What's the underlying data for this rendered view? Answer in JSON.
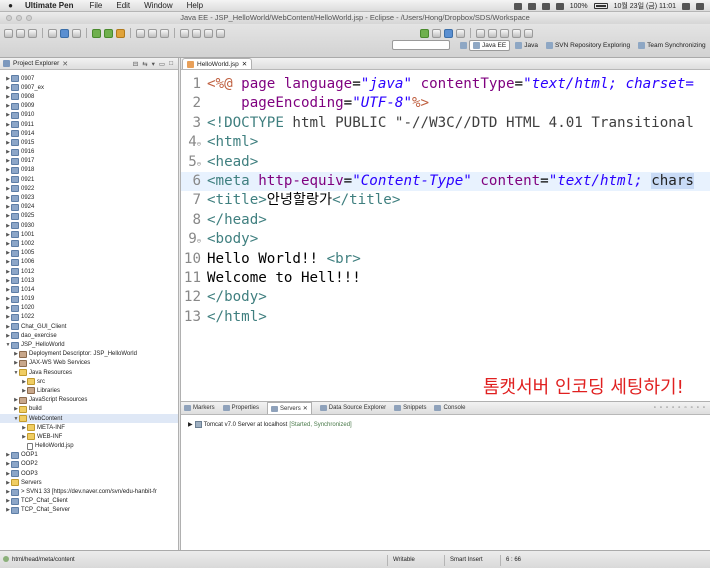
{
  "menubar": {
    "app": "Ultimate Pen",
    "items": [
      "File",
      "Edit",
      "Window",
      "Help"
    ],
    "battery": "100%",
    "datetime": "10월 23일 (금) 11:01"
  },
  "window": {
    "title": "Java EE - JSP_HelloWorld/WebContent/HelloWorld.jsp - Eclipse - /Users/Hong/Dropbox/SDS/Workspace"
  },
  "perspectives": [
    {
      "label": "Java EE",
      "active": true
    },
    {
      "label": "Java",
      "active": false
    },
    {
      "label": "SVN Repository Exploring",
      "active": false
    },
    {
      "label": "Team Synchronizing",
      "active": false
    }
  ],
  "explorer": {
    "title": "Project Explorer",
    "items": [
      {
        "label": "0907",
        "kind": "project",
        "depth": 0
      },
      {
        "label": "0907_ex",
        "kind": "project",
        "depth": 0
      },
      {
        "label": "0908",
        "kind": "project",
        "depth": 0
      },
      {
        "label": "0909",
        "kind": "project",
        "depth": 0
      },
      {
        "label": "0910",
        "kind": "project",
        "depth": 0
      },
      {
        "label": "0911",
        "kind": "project",
        "depth": 0
      },
      {
        "label": "0914",
        "kind": "project",
        "depth": 0
      },
      {
        "label": "0915",
        "kind": "project",
        "depth": 0
      },
      {
        "label": "0916",
        "kind": "project",
        "depth": 0
      },
      {
        "label": "0917",
        "kind": "project",
        "depth": 0
      },
      {
        "label": "0918",
        "kind": "project",
        "depth": 0
      },
      {
        "label": "0921",
        "kind": "project",
        "depth": 0
      },
      {
        "label": "0922",
        "kind": "project",
        "depth": 0
      },
      {
        "label": "0923",
        "kind": "project",
        "depth": 0
      },
      {
        "label": "0924",
        "kind": "project",
        "depth": 0
      },
      {
        "label": "0925",
        "kind": "project",
        "depth": 0
      },
      {
        "label": "0930",
        "kind": "project",
        "depth": 0
      },
      {
        "label": "1001",
        "kind": "project",
        "depth": 0
      },
      {
        "label": "1002",
        "kind": "project",
        "depth": 0
      },
      {
        "label": "1005",
        "kind": "project",
        "depth": 0
      },
      {
        "label": "1006",
        "kind": "project",
        "depth": 0
      },
      {
        "label": "1012",
        "kind": "project",
        "depth": 0
      },
      {
        "label": "1013",
        "kind": "project",
        "depth": 0
      },
      {
        "label": "1014",
        "kind": "project",
        "depth": 0
      },
      {
        "label": "1019",
        "kind": "project",
        "depth": 0
      },
      {
        "label": "1020",
        "kind": "project",
        "depth": 0
      },
      {
        "label": "1022",
        "kind": "project",
        "depth": 0
      },
      {
        "label": "Chat_GUI_Client",
        "kind": "project",
        "depth": 0
      },
      {
        "label": "dao_exercise",
        "kind": "project",
        "depth": 0
      },
      {
        "label": "JSP_HelloWorld",
        "kind": "project",
        "depth": 0,
        "expanded": true
      },
      {
        "label": "Deployment Descriptor: JSP_HelloWorld",
        "kind": "lib",
        "depth": 1
      },
      {
        "label": "JAX-WS Web Services",
        "kind": "lib",
        "depth": 1
      },
      {
        "label": "Java Resources",
        "kind": "folder",
        "depth": 1,
        "expanded": true
      },
      {
        "label": "src",
        "kind": "folder",
        "depth": 2
      },
      {
        "label": "Libraries",
        "kind": "lib",
        "depth": 2
      },
      {
        "label": "JavaScript Resources",
        "kind": "lib",
        "depth": 1
      },
      {
        "label": "build",
        "kind": "folder",
        "depth": 1
      },
      {
        "label": "WebContent",
        "kind": "folder",
        "depth": 1,
        "expanded": true,
        "selected": true
      },
      {
        "label": "META-INF",
        "kind": "folder",
        "depth": 2
      },
      {
        "label": "WEB-INF",
        "kind": "folder",
        "depth": 2
      },
      {
        "label": "HelloWorld.jsp",
        "kind": "file",
        "depth": 2
      },
      {
        "label": "OOP1",
        "kind": "project",
        "depth": 0
      },
      {
        "label": "OOP2",
        "kind": "project",
        "depth": 0
      },
      {
        "label": "OOP3",
        "kind": "project",
        "depth": 0
      },
      {
        "label": "Servers",
        "kind": "folder",
        "depth": 0
      },
      {
        "label": "> SVN1 33 [https://dev.naver.com/svn/edu-hanbit-fr",
        "kind": "project",
        "depth": 0
      },
      {
        "label": "TCP_Chat_Client",
        "kind": "project",
        "depth": 0
      },
      {
        "label": "TCP_Chat_Server",
        "kind": "project",
        "depth": 0
      }
    ]
  },
  "editor": {
    "tab": "HelloWorld.jsp",
    "overlay_text": "톰캣서버 인코딩 세팅하기!",
    "lines": [
      {
        "n": "1",
        "fold": "",
        "parts": [
          [
            "pct",
            "<%@ "
          ],
          [
            "attr",
            "page language"
          ],
          [
            "txt",
            "="
          ],
          [
            "val",
            "\"java\""
          ],
          [
            "txt",
            " "
          ],
          [
            "attr",
            "contentType"
          ],
          [
            "txt",
            "="
          ],
          [
            "val",
            "\"text/html; charset="
          ]
        ]
      },
      {
        "n": "2",
        "fold": "",
        "parts": [
          [
            "txt",
            "    "
          ],
          [
            "attr",
            "pageEncoding"
          ],
          [
            "txt",
            "="
          ],
          [
            "val",
            "\"UTF-8\""
          ],
          [
            "pct",
            "%>"
          ]
        ]
      },
      {
        "n": "3",
        "fold": "",
        "parts": [
          [
            "tag",
            "<!DOCTYPE "
          ],
          [
            "dt",
            "html PUBLIC \"-//W3C//DTD HTML 4.01 Transitional"
          ]
        ]
      },
      {
        "n": "4",
        "fold": "⊖",
        "parts": [
          [
            "tag",
            "<html>"
          ]
        ]
      },
      {
        "n": "5",
        "fold": "⊖",
        "parts": [
          [
            "tag",
            "<head>"
          ]
        ]
      },
      {
        "n": "6",
        "fold": "",
        "cur": true,
        "parts": [
          [
            "tag",
            "<meta "
          ],
          [
            "attr",
            "http-equiv"
          ],
          [
            "txt",
            "="
          ],
          [
            "val",
            "\"Content-Type\""
          ],
          [
            "txt",
            " "
          ],
          [
            "attr",
            "content"
          ],
          [
            "txt",
            "="
          ],
          [
            "val",
            "\"text/html; "
          ],
          [
            "hl",
            "chars"
          ]
        ]
      },
      {
        "n": "7",
        "fold": "",
        "parts": [
          [
            "tag",
            "<title>"
          ],
          [
            "txt",
            "안녕할랑가"
          ],
          [
            "tag",
            "</title>"
          ]
        ]
      },
      {
        "n": "8",
        "fold": "",
        "parts": [
          [
            "tag",
            "</head>"
          ]
        ]
      },
      {
        "n": "9",
        "fold": "⊖",
        "parts": [
          [
            "tag",
            "<body>"
          ]
        ]
      },
      {
        "n": "10",
        "fold": "",
        "parts": [
          [
            "txt",
            "Hello World!! "
          ],
          [
            "tag",
            "<br>"
          ]
        ]
      },
      {
        "n": "11",
        "fold": "",
        "parts": [
          [
            "txt",
            "Welcome to Hell!!!"
          ]
        ]
      },
      {
        "n": "12",
        "fold": "",
        "parts": [
          [
            "tag",
            "</body>"
          ]
        ]
      },
      {
        "n": "13",
        "fold": "",
        "parts": [
          [
            "tag",
            "</html>"
          ]
        ]
      }
    ]
  },
  "bottom_panel": {
    "tabs": [
      {
        "label": "Markers",
        "active": false
      },
      {
        "label": "Properties",
        "active": false
      },
      {
        "label": "Servers",
        "active": true
      },
      {
        "label": "Data Source Explorer",
        "active": false
      },
      {
        "label": "Snippets",
        "active": false
      },
      {
        "label": "Console",
        "active": false
      }
    ],
    "server": {
      "name": "Tomcat v7.0 Server at localhost",
      "state": "[Started, Synchronized]"
    }
  },
  "statusbar": {
    "path": "html/head/meta/content",
    "mode": "Writable",
    "insert": "Smart Insert",
    "position": "6 : 66"
  }
}
